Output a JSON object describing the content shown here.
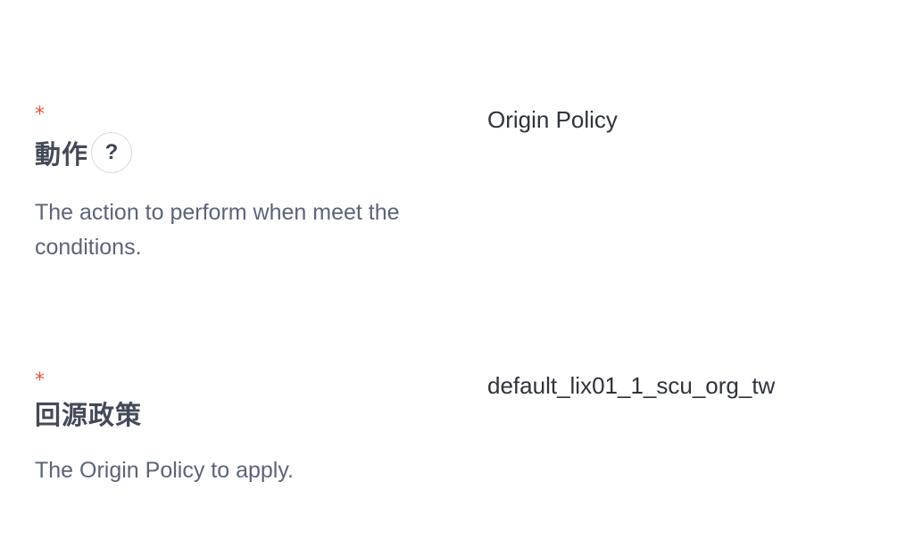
{
  "fields": {
    "action": {
      "required_mark": "*",
      "label": "動作",
      "help_icon": "?",
      "description": "The action to perform when meet the conditions.",
      "value": "Origin Policy"
    },
    "origin_policy": {
      "required_mark": "*",
      "label": "回源政策",
      "description": "The Origin Policy to apply.",
      "value": "default_lix01_1_scu_org_tw"
    }
  }
}
